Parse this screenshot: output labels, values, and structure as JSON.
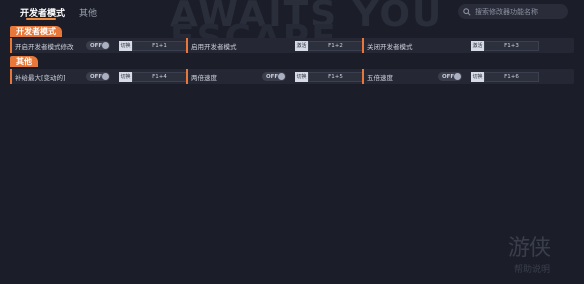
{
  "watermark": {
    "line1": "AWAITS YOU",
    "line2": "ESCAPE"
  },
  "tabs": [
    {
      "label": "开发者模式",
      "active": true
    },
    {
      "label": "其他",
      "active": false
    }
  ],
  "search": {
    "placeholder": "搜索修改器功能名称",
    "icon": "search-icon"
  },
  "sections": [
    {
      "title": "开发者模式",
      "items": [
        {
          "label": "开启开发者模式修改",
          "toggle": "OFF",
          "key_tag": "切换",
          "key": "F1+1"
        },
        {
          "label": "启用开发者模式",
          "key_tag": "激活",
          "key": "F1+2"
        },
        {
          "label": "关闭开发者模式",
          "key_tag": "激活",
          "key": "F1+3"
        }
      ]
    },
    {
      "title": "其他",
      "items": [
        {
          "label": "补给最大[变动的]",
          "toggle": "OFF",
          "key_tag": "切换",
          "key": "F1+4"
        },
        {
          "label": "两倍速度",
          "toggle": "OFF",
          "key_tag": "切换",
          "key": "F1+5"
        },
        {
          "label": "五倍速度",
          "toggle": "OFF",
          "key_tag": "切换",
          "key": "F1+6"
        }
      ]
    }
  ],
  "help": {
    "logo": "游侠",
    "text": "帮助说明"
  },
  "colors": {
    "accent": "#e8783a",
    "background": "#1b1e29",
    "row": "#252834"
  }
}
